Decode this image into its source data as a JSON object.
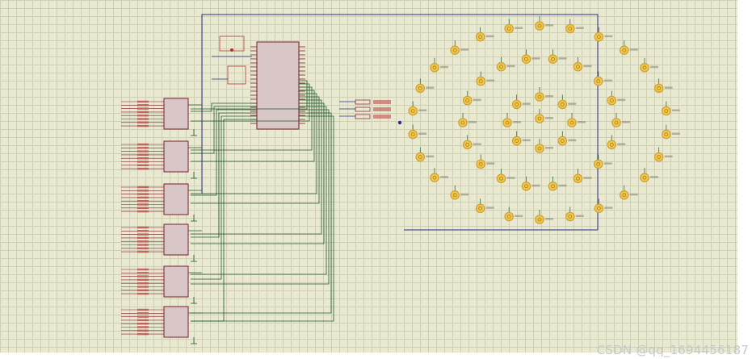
{
  "watermark": "CSDN @qq_1694456187",
  "colors": {
    "sheet": "#e9e9d2",
    "wire_blue": "#2b2f8c",
    "wire_green": "#1f5a2a",
    "chip_fill": "#d9c7c7",
    "chip_stroke": "#7a1f2f",
    "led_fill": "#f3c64a",
    "led_ring": "#caa23a",
    "resistor": "#b33a3a"
  },
  "icons": {
    "led": "lamp-icon",
    "microcontroller": "ic-chip-icon",
    "driver": "shift-register-icon",
    "buttons": "push-button-icon"
  }
}
